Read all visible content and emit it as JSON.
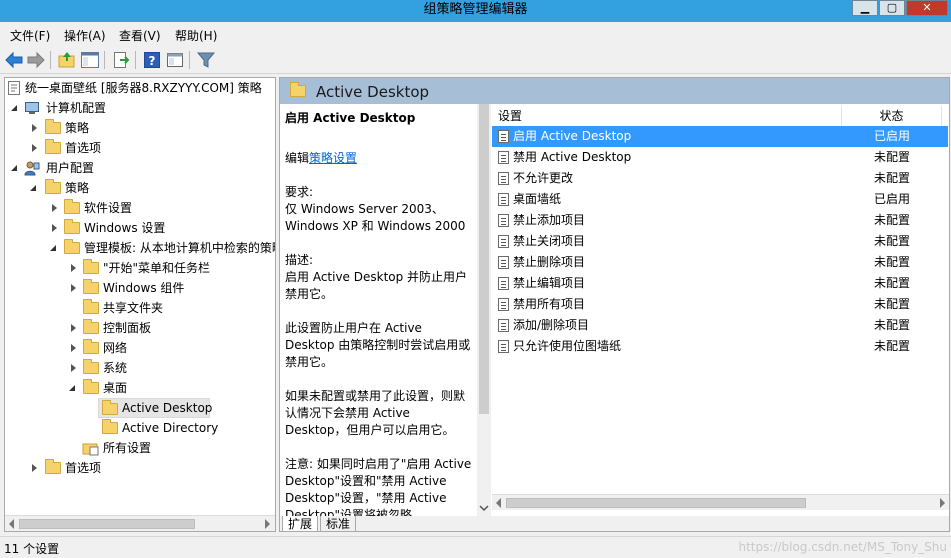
{
  "window": {
    "title": "组策略管理编辑器",
    "controls": [
      "▁",
      "▢",
      "✕"
    ]
  },
  "menu": [
    "文件(F)",
    "操作(A)",
    "查看(V)",
    "帮助(H)"
  ],
  "tree": {
    "root": "统一桌面壁纸 [服务器8.RXZYYY.COM] 策略",
    "computer_config": "计算机配置",
    "cc_policies": "策略",
    "cc_preferences": "首选项",
    "user_config": "用户配置",
    "uc_policies": "策略",
    "software_settings": "软件设置",
    "windows_settings": "Windows 设置",
    "admin_templates": "管理模板: 从本地计算机中检索的策略",
    "start_menu": "\"开始\"菜单和任务栏",
    "windows_components": "Windows 组件",
    "shared_folders": "共享文件夹",
    "control_panel": "控制面板",
    "network": "网络",
    "system": "系统",
    "desktop": "桌面",
    "active_desktop": "Active Desktop",
    "active_directory": "Active Directory",
    "all_settings": "所有设置",
    "uc_preferences": "首选项"
  },
  "header": {
    "title": "Active Desktop"
  },
  "description": {
    "title": "启用 Active Desktop",
    "edit_prefix": "编辑",
    "edit_link": "策略设置",
    "req_label": "要求:",
    "req_text": "仅 Windows Server 2003、Windows XP 和 Windows 2000",
    "desc_label": "描述:",
    "desc_text": "启用 Active Desktop 并防止用户禁用它。",
    "para1": "此设置防止用户在 Active Desktop 由策略控制时尝试启用或禁用它。",
    "para2": "如果未配置或禁用了此设置，则默认情况下会禁用 Active Desktop，但用户可以启用它。",
    "para3": "注意: 如果同时启用了\"启用 Active Desktop\"设置和\"禁用 Active Desktop\"设置，\"禁用 Active Desktop\"设置将被忽略。"
  },
  "list": {
    "col_setting": "设置",
    "col_state": "状态",
    "rows": [
      {
        "name": "启用 Active Desktop",
        "state": "已启用"
      },
      {
        "name": "禁用 Active Desktop",
        "state": "未配置"
      },
      {
        "name": "不允许更改",
        "state": "未配置"
      },
      {
        "name": "桌面墙纸",
        "state": "已启用"
      },
      {
        "name": "禁止添加项目",
        "state": "未配置"
      },
      {
        "name": "禁止关闭项目",
        "state": "未配置"
      },
      {
        "name": "禁止删除项目",
        "state": "未配置"
      },
      {
        "name": "禁止编辑项目",
        "state": "未配置"
      },
      {
        "name": "禁用所有项目",
        "state": "未配置"
      },
      {
        "name": "添加/删除项目",
        "state": "未配置"
      },
      {
        "name": "只允许使用位图墙纸",
        "state": "未配置"
      }
    ]
  },
  "tabs": [
    "扩展",
    "标准"
  ],
  "status": {
    "text": "11 个设置",
    "watermark": "https://blog.csdn.net/MS_Tony_Shu"
  },
  "colors": {
    "titlebar": "#33a1e0",
    "header": "#a6bed6",
    "selection": "#3399ff",
    "link": "#0066cc"
  }
}
